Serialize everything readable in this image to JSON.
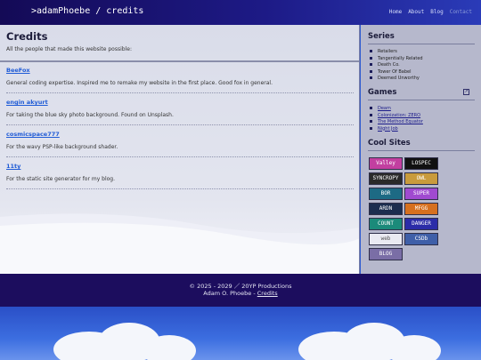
{
  "header": {
    "site_title": ">adamPhoebe / credits",
    "nav": [
      "Home",
      "About",
      "Blog",
      "Contact"
    ]
  },
  "main": {
    "title": "Credits",
    "intro": "All the people that made this website possible:",
    "credits": [
      {
        "name": "BeeFox",
        "desc": "General coding expertise. Inspired me to remake my website in the first place. Good fox in general."
      },
      {
        "name": "engin akyurt",
        "desc": "For taking the blue sky photo background. Found on Unsplash."
      },
      {
        "name": "cosmicspace777",
        "desc": "For the wavy PSP-like background shader."
      },
      {
        "name": "11ty",
        "desc": "For the static site generator for my blog."
      }
    ]
  },
  "sidebar": {
    "series_title": "Series",
    "series": [
      "Retailers",
      "Tangentially Related",
      "Death Co.",
      "Tower Of Babel",
      "Deemed Unworthy"
    ],
    "games_title": "Games",
    "games": [
      "Deam",
      "Colonization: ZERO",
      "The Method Equator",
      "Night Job"
    ],
    "cool_title": "Cool Sites",
    "badges": [
      {
        "text": "Valley",
        "bg": "#c23fa0"
      },
      {
        "text": "LOSPEC",
        "bg": "#111111"
      },
      {
        "text": "SYNCROPY",
        "bg": "#2a2a2a"
      },
      {
        "text": "OWL",
        "bg": "#c99b3c"
      },
      {
        "text": "BOR",
        "bg": "#1d6a84"
      },
      {
        "text": "SUPER",
        "bg": "#a04ad0"
      },
      {
        "text": "ARDN",
        "bg": "#1c2d4f"
      },
      {
        "text": "MFGG",
        "bg": "#d6701f"
      },
      {
        "text": "COUNT",
        "bg": "#1b8a7a"
      },
      {
        "text": "DANGER",
        "bg": "#2b2ca8"
      },
      {
        "text": "web",
        "bg": "#eaeaf2"
      },
      {
        "text": "CSDb",
        "bg": "#3f5fa8"
      },
      {
        "text": "BLOG",
        "bg": "#7a6ea6"
      }
    ]
  },
  "footer": {
    "copyright": "© 2025 - 2029 ／ 20YP Productions",
    "author": "Adam O. Phoebe - ",
    "credits_link": "Credits"
  },
  "colors": {
    "header_bg": "#140a56",
    "footer_bg": "#1c0d5e",
    "link": "#1f5bd6",
    "sidebar_bg": "#b6b8cc"
  }
}
